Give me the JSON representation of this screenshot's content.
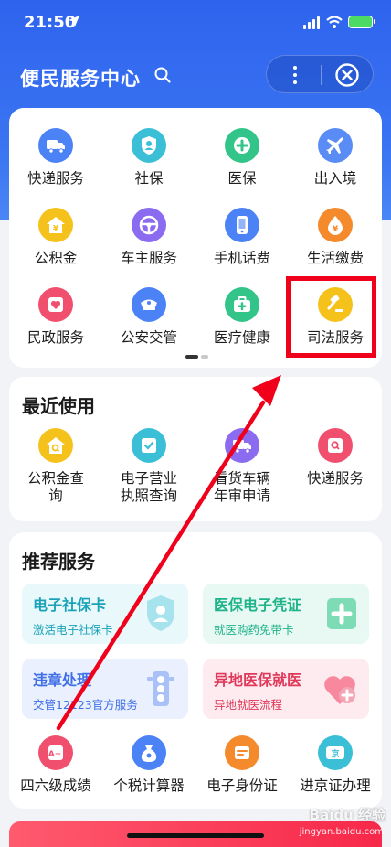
{
  "status_bar": {
    "time": "21:50"
  },
  "header": {
    "title": "便民服务中心"
  },
  "services": {
    "items": [
      {
        "label": "快递服务",
        "icon": "truck-icon",
        "color": "#4b82f5"
      },
      {
        "label": "社保",
        "icon": "shield-person-icon",
        "color": "#3bbfd6"
      },
      {
        "label": "医保",
        "icon": "medical-cross-icon",
        "color": "#33c48a"
      },
      {
        "label": "出入境",
        "icon": "airplane-icon",
        "color": "#5a8cf6"
      },
      {
        "label": "公积金",
        "icon": "house-yuan-icon",
        "color": "#f5c21b"
      },
      {
        "label": "车主服务",
        "icon": "steering-wheel-icon",
        "color": "#8b6cf0"
      },
      {
        "label": "手机话费",
        "icon": "phone-icon",
        "color": "#4b82f5"
      },
      {
        "label": "生活缴费",
        "icon": "water-drop-icon",
        "color": "#f58a2d"
      },
      {
        "label": "民政服务",
        "icon": "heart-icon",
        "color": "#f0506e"
      },
      {
        "label": "公安交管",
        "icon": "police-cap-icon",
        "color": "#4b82f5"
      },
      {
        "label": "医疗健康",
        "icon": "medical-kit-icon",
        "color": "#33c48a"
      },
      {
        "label": "司法服务",
        "icon": "gavel-icon",
        "color": "#f5c21b"
      }
    ]
  },
  "recent": {
    "title": "最近使用",
    "items": [
      {
        "label": "公积金查询",
        "icon": "house-search-icon",
        "color": "#f5c21b"
      },
      {
        "label": "电子营业执照查询",
        "icon": "license-icon",
        "color": "#3bbfd6"
      },
      {
        "label": "看货车辆年审申请",
        "icon": "truck-check-icon",
        "color": "#8b6cf0"
      },
      {
        "label": "快递服务",
        "icon": "package-search-icon",
        "color": "#f0506e"
      }
    ]
  },
  "recommended": {
    "title": "推荐服务",
    "cards": [
      {
        "title": "电子社保卡",
        "subtitle": "激活电子社保卡",
        "icon": "shield-person-icon",
        "title_color": "#1aa3b8",
        "bg": "#e9f8fa"
      },
      {
        "title": "医保电子凭证",
        "subtitle": "就医购药免带卡",
        "icon": "medical-card-icon",
        "title_color": "#1fb38a",
        "bg": "#e8f8f2"
      },
      {
        "title": "违章处理",
        "subtitle": "交管12123官方服务",
        "icon": "traffic-light-icon",
        "title_color": "#3e6fe6",
        "bg": "#eaf0fd"
      },
      {
        "title": "异地医保就医",
        "subtitle": "异地就医流程",
        "icon": "heart-plus-icon",
        "title_color": "#e0385a",
        "bg": "#fdebef"
      }
    ],
    "items": [
      {
        "label": "四六级成绩",
        "icon": "grade-icon",
        "color": "#f0506e"
      },
      {
        "label": "个税计算器",
        "icon": "tax-bag-icon",
        "color": "#4b82f5"
      },
      {
        "label": "电子身份证",
        "icon": "id-card-icon",
        "color": "#f58a2d"
      },
      {
        "label": "进京证办理",
        "icon": "beijing-pass-icon",
        "color": "#3bbfd6"
      }
    ]
  },
  "watermark": {
    "brand": "Baidu 经验",
    "url": "jingyan.baidu.com"
  }
}
